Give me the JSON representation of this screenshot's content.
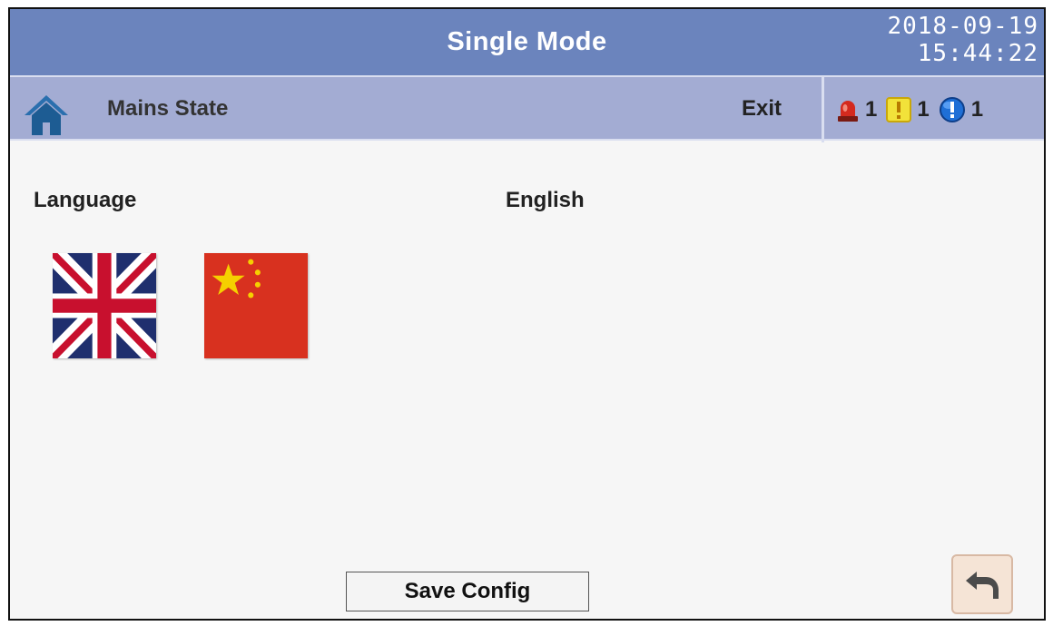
{
  "header": {
    "title": "Single Mode",
    "date": "2018-09-19",
    "time": "15:44:22"
  },
  "subbar": {
    "home_icon": "home-icon",
    "breadcrumb": "Mains State",
    "exit_label": "Exit",
    "alarms": [
      {
        "icon": "red-alarm-light-icon",
        "count": "1",
        "color": "#d42a1e"
      },
      {
        "icon": "yellow-warning-icon",
        "count": "1",
        "color": "#f2e23a"
      },
      {
        "icon": "blue-info-icon",
        "count": "1",
        "color": "#1f6fd6"
      }
    ]
  },
  "settings": {
    "language_label": "Language",
    "language_value": "English",
    "flags": [
      {
        "icon": "uk-flag-icon"
      },
      {
        "icon": "china-flag-icon"
      }
    ]
  },
  "footer": {
    "save_label": "Save Config",
    "back_icon": "back-arrow-icon"
  },
  "colors": {
    "title_bar": "#6b84bd",
    "sub_bar": "#a3acd3",
    "background": "#f6f6f6"
  }
}
